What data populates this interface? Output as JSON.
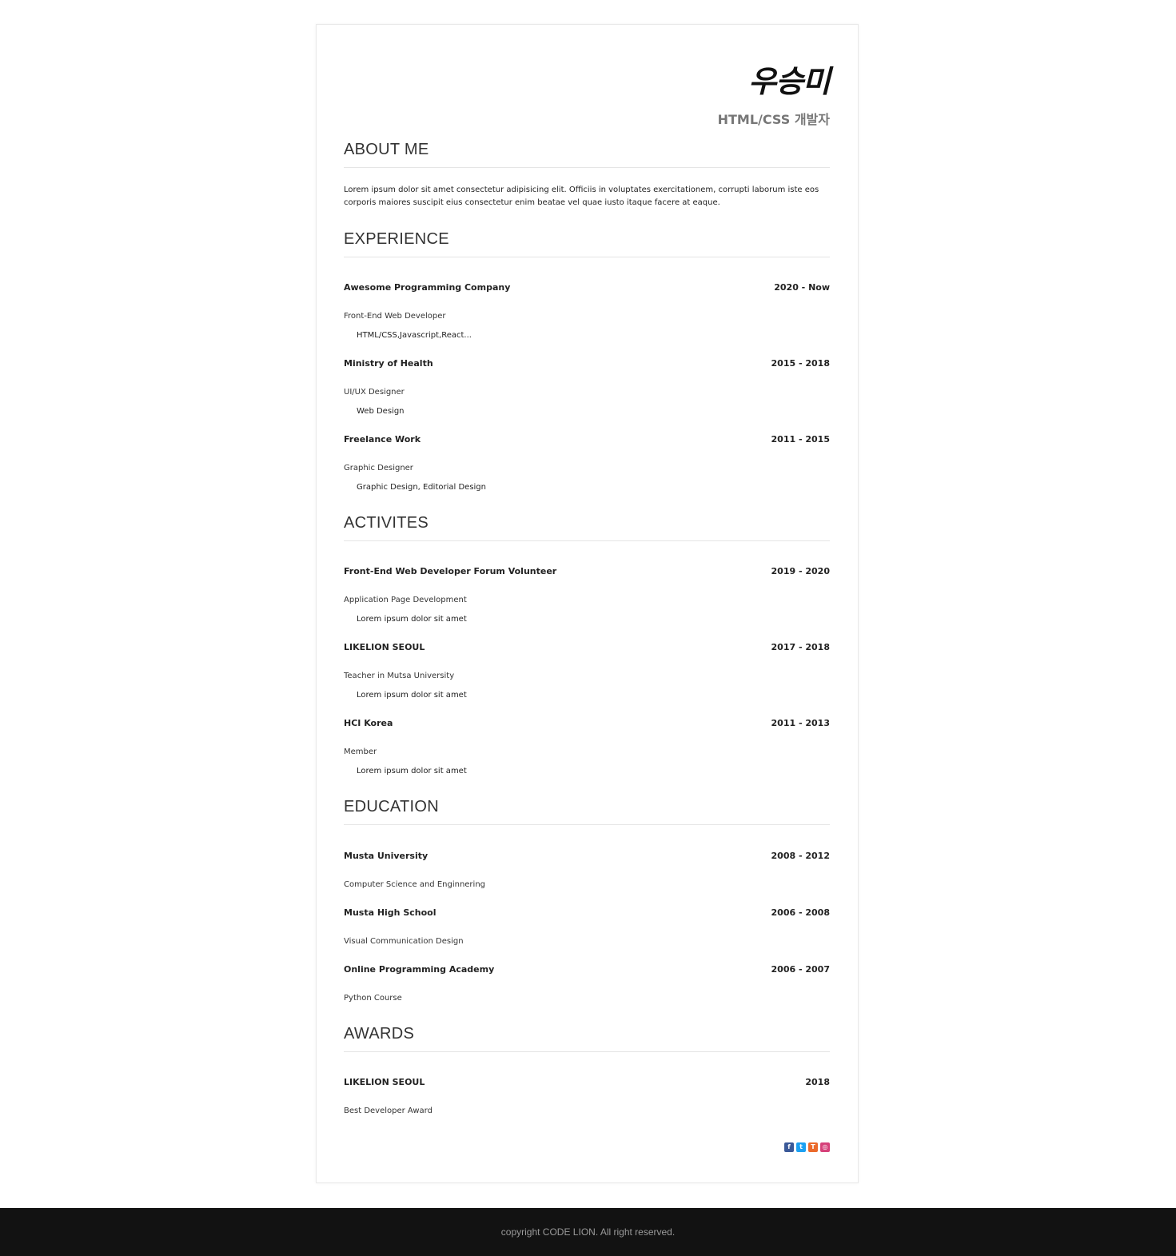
{
  "header": {
    "name": "우승미",
    "role": "HTML/CSS 개발자"
  },
  "about": {
    "title": "ABOUT ME",
    "text": "Lorem ipsum dolor sit amet consectetur adipisicing elit. Officiis in voluptates exercitationem, corrupti laborum iste eos corporis maiores suscipit eius consectetur enim beatae vel quae iusto itaque facere at eaque."
  },
  "experience": {
    "title": "EXPERIENCE",
    "items": [
      {
        "title": "Awesome Programming Company",
        "date": "2020 - Now",
        "sub": "Front-End Web Developer",
        "detail": "HTML/CSS,Javascript,React..."
      },
      {
        "title": "Ministry of Health",
        "date": "2015 - 2018",
        "sub": "UI/UX Designer",
        "detail": "Web Design"
      },
      {
        "title": "Freelance Work",
        "date": "2011 - 2015",
        "sub": "Graphic Designer",
        "detail": "Graphic Design, Editorial Design"
      }
    ]
  },
  "activities": {
    "title": "ACTIVITES",
    "items": [
      {
        "title": "Front-End Web Developer Forum Volunteer",
        "date": "2019 - 2020",
        "sub": "Application Page Development",
        "detail": "Lorem ipsum dolor sit amet"
      },
      {
        "title": "LIKELION SEOUL",
        "date": "2017 - 2018",
        "sub": "Teacher in Mutsa University",
        "detail": "Lorem ipsum dolor sit amet"
      },
      {
        "title": "HCI Korea",
        "date": "2011 - 2013",
        "sub": "Member",
        "detail": "Lorem ipsum dolor sit amet"
      }
    ]
  },
  "education": {
    "title": "EDUCATION",
    "items": [
      {
        "title": "Musta University",
        "date": "2008 - 2012",
        "sub": "Computer Science and Enginnering"
      },
      {
        "title": "Musta High School",
        "date": "2006 - 2008",
        "sub": "Visual Communication Design"
      },
      {
        "title": "Online Programming Academy",
        "date": "2006 - 2007",
        "sub": "Python Course"
      }
    ]
  },
  "awards": {
    "title": "AWARDS",
    "items": [
      {
        "title": "LIKELION SEOUL",
        "date": "2018",
        "sub": "Best Developer Award"
      }
    ]
  },
  "social": {
    "icons": [
      {
        "name": "facebook-icon",
        "glyph": "f",
        "color": "#3b5998"
      },
      {
        "name": "twitter-icon",
        "glyph": "t",
        "color": "#1da1f2"
      },
      {
        "name": "tistory-icon",
        "glyph": "T",
        "color": "#eb6a2b"
      },
      {
        "name": "instagram-icon",
        "glyph": "◎",
        "color": "#d6417a"
      }
    ]
  },
  "footer": {
    "copyright": "copyright CODE LION. All right reserved."
  }
}
